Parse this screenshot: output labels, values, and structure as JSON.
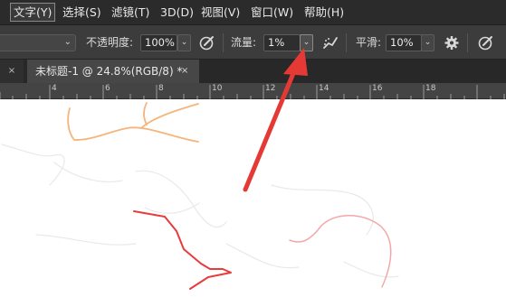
{
  "menubar": {
    "items": [
      {
        "label": "文字(Y)"
      },
      {
        "label": "选择(S)"
      },
      {
        "label": "滤镜(T)"
      },
      {
        "label": "3D(D)"
      },
      {
        "label": "视图(V)"
      },
      {
        "label": "窗口(W)"
      },
      {
        "label": "帮助(H)"
      }
    ]
  },
  "options": {
    "opacity_label": "不透明度:",
    "opacity_value": "100%",
    "flow_label": "流量:",
    "flow_value": "1%",
    "smoothing_label": "平滑:",
    "smoothing_value": "10%"
  },
  "tabs": {
    "active_title": "未标题-1 @ 24.8%(RGB/8) *",
    "close_glyph": "×"
  },
  "ruler": {
    "labels": [
      "4",
      "6",
      "8",
      "10",
      "12",
      "14",
      "16",
      "18"
    ]
  },
  "colors": {
    "menubar_bg": "#2b2b2b",
    "optionsbar_bg": "#3c3c3c",
    "annotation_arrow": "#e53935",
    "stroke_orange": "#f5a75a",
    "stroke_red": "#e83a3a",
    "stroke_pink": "#f2a0a0"
  }
}
